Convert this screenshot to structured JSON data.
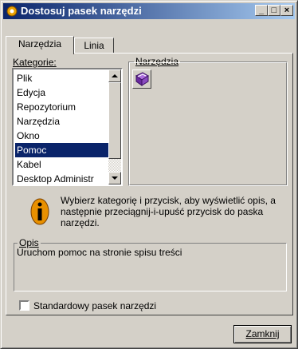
{
  "window": {
    "title": "Dostosuj pasek narzędzi",
    "minimize_label": "_",
    "maximize_label": "□",
    "close_label": "×"
  },
  "tabs": [
    {
      "label": "Narzędzia",
      "active": true
    },
    {
      "label": "Linia",
      "active": false
    }
  ],
  "categories": {
    "label": "Kategorie:",
    "items": [
      "Plik",
      "Edycja",
      "Repozytorium",
      "Narzędzia",
      "Okno",
      "Pomoc",
      "Kabel",
      "Desktop Administr"
    ],
    "selected": "Pomoc"
  },
  "tools": {
    "label": "Narzędzia",
    "items": [
      {
        "icon": "help-book-icon"
      }
    ]
  },
  "hint": {
    "icon": "info-icon",
    "text": "Wybierz kategorię i przycisk, aby wyświetlić opis, a następnie przeciągnij-i-upuść przycisk do paska narzędzi."
  },
  "description": {
    "label": "Opis",
    "text": "Uruchom pomoc na stronie spisu treści"
  },
  "standard_toolbar": {
    "label": "Standardowy pasek narzędzi",
    "checked": false
  },
  "close_button": {
    "label": "Zamknij"
  },
  "colors": {
    "titlebar_start": "#0a246a",
    "titlebar_end": "#a6caf0",
    "selection": "#0a246a",
    "face": "#d4d0c8"
  }
}
